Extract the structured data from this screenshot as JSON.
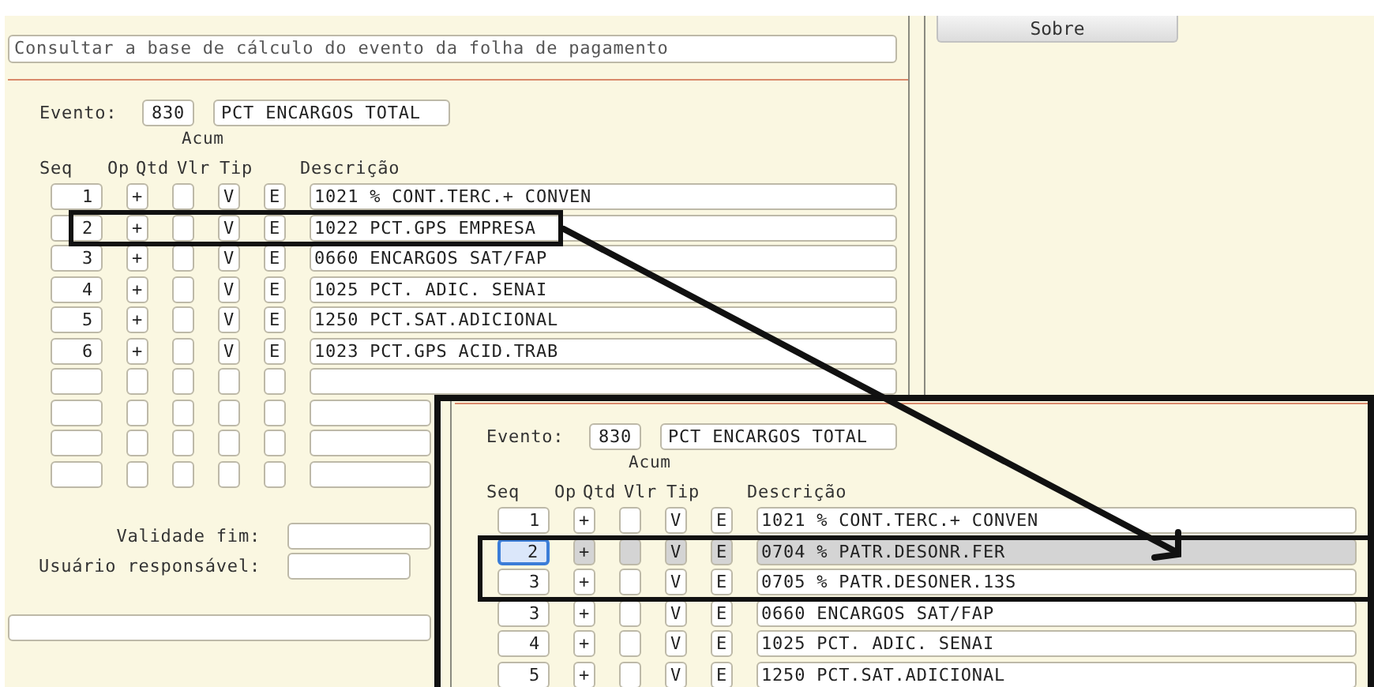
{
  "header": {
    "description": "Consultar a base de cálculo do evento da folha de pagamento"
  },
  "sidebar": {
    "about_button": "Sobre"
  },
  "form": {
    "event_label": "Evento:",
    "event_code": "830",
    "event_name": "PCT ENCARGOS TOTAL",
    "group_label": "Acum",
    "columns": [
      "Seq",
      "Op",
      "Qtd",
      "Vlr",
      "Tip",
      "Descrição"
    ],
    "rows": [
      {
        "seq": "1",
        "op": "+",
        "vlr": "V",
        "tip": "E",
        "description": "1021 % CONT.TERC.+ CONVEN",
        "selected": false
      },
      {
        "seq": "2",
        "op": "+",
        "vlr": "V",
        "tip": "E",
        "description": "1022 PCT.GPS EMPRESA",
        "selected": false
      },
      {
        "seq": "3",
        "op": "+",
        "vlr": "V",
        "tip": "E",
        "description": "0660 ENCARGOS SAT/FAP",
        "selected": false
      },
      {
        "seq": "4",
        "op": "+",
        "vlr": "V",
        "tip": "E",
        "description": "1025 PCT. ADIC. SENAI",
        "selected": false
      },
      {
        "seq": "5",
        "op": "+",
        "vlr": "V",
        "tip": "E",
        "description": "1250 PCT.SAT.ADICIONAL",
        "selected": false
      },
      {
        "seq": "6",
        "op": "+",
        "vlr": "V",
        "tip": "E",
        "description": "1023 PCT.GPS ACID.TRAB",
        "selected": false
      },
      {
        "selected": false
      },
      {
        "selected": false
      },
      {
        "selected": false
      },
      {
        "selected": false
      }
    ],
    "validity_label": "Validade fim:",
    "user_label": "Usuário responsável:"
  },
  "inset": {
    "event_label": "Evento:",
    "event_code": "830",
    "event_name": "PCT ENCARGOS TOTAL",
    "group_label": "Acum",
    "columns": [
      "Seq",
      "Op",
      "Qtd",
      "Vlr",
      "Tip",
      "Descrição"
    ],
    "rows": [
      {
        "seq": "1",
        "op": "+",
        "vlr": "V",
        "tip": "E",
        "description": "1021 % CONT.TERC.+ CONVEN",
        "selected": false
      },
      {
        "seq": "2",
        "op": "+",
        "vlr": "V",
        "tip": "E",
        "description": "0704 % PATR.DESONR.FER",
        "selected": true
      },
      {
        "seq": "3",
        "op": "+",
        "vlr": "V",
        "tip": "E",
        "description": "0705 % PATR.DESONER.13S",
        "selected": false
      },
      {
        "seq": "3",
        "op": "+",
        "vlr": "V",
        "tip": "E",
        "description": "0660 ENCARGOS SAT/FAP",
        "selected": false
      },
      {
        "seq": "4",
        "op": "+",
        "vlr": "V",
        "tip": "E",
        "description": "1025 PCT. ADIC. SENAI",
        "selected": false
      },
      {
        "seq": "5",
        "op": "+",
        "vlr": "V",
        "tip": "E",
        "description": "1250 PCT.SAT.ADICIONAL",
        "selected": false
      }
    ]
  }
}
